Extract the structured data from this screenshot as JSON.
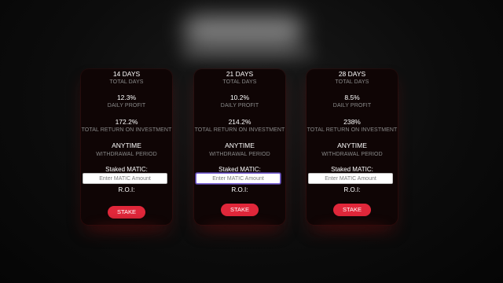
{
  "plans": [
    {
      "days": "14 DAYS",
      "days_label": "TOTAL DAYS",
      "daily_profit": "12.3%",
      "daily_profit_label": "DAILY PROFIT",
      "total_return": "172.2%",
      "total_return_label": "TOTAL RETURN ON INVESTMENT",
      "withdrawal": "ANYTIME",
      "withdrawal_label": "WITHDRAWAL PERIOD",
      "staked_label": "Staked MATIC:",
      "amount_placeholder": "Enter MATIC Amount",
      "amount_value": "",
      "roi_label": "R.O.I:",
      "stake_label": "STAKE"
    },
    {
      "days": "21 DAYS",
      "days_label": "TOTAL DAYS",
      "daily_profit": "10.2%",
      "daily_profit_label": "DAILY PROFIT",
      "total_return": "214.2%",
      "total_return_label": "TOTAL RETURN ON INVESTMENT",
      "withdrawal": "ANYTIME",
      "withdrawal_label": "WITHDRAWAL PERIOD",
      "staked_label": "Staked MATIC:",
      "amount_placeholder": "Enter MATIC Amount",
      "amount_value": "",
      "roi_label": "R.O.I:",
      "stake_label": "STAKE"
    },
    {
      "days": "28 DAYS",
      "days_label": "TOTAL DAYS",
      "daily_profit": "8.5%",
      "daily_profit_label": "DAILY PROFIT",
      "total_return": "238%",
      "total_return_label": "TOTAL RETURN ON INVESTMENT",
      "withdrawal": "ANYTIME",
      "withdrawal_label": "WITHDRAWAL PERIOD",
      "staked_label": "Staked MATIC:",
      "amount_placeholder": "Enter MATIC Amount",
      "amount_value": "",
      "roi_label": "R.O.I:",
      "stake_label": "STAKE"
    }
  ],
  "colors": {
    "accent": "#e0273a",
    "card_background": "#0f0505",
    "label_gray": "#8a8a8a"
  }
}
